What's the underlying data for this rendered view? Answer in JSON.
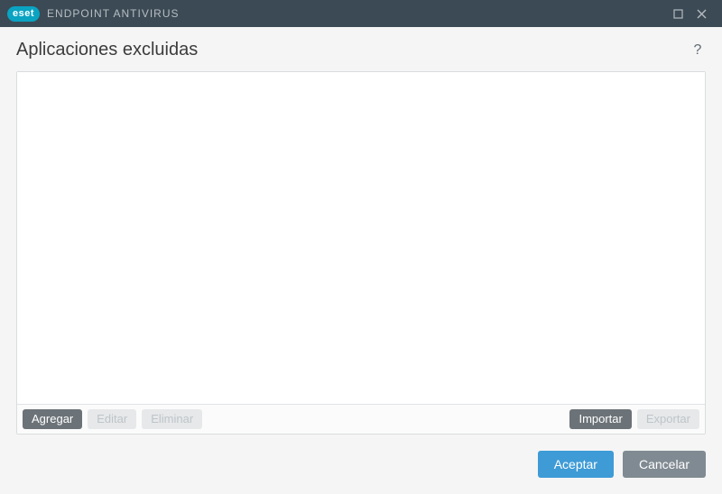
{
  "titlebar": {
    "brand": "eset",
    "product": "ENDPOINT ANTIVIRUS"
  },
  "page": {
    "title": "Aplicaciones excluidas",
    "help": "?"
  },
  "toolbar": {
    "add": "Agregar",
    "edit": "Editar",
    "delete": "Eliminar",
    "import": "Importar",
    "export": "Exportar"
  },
  "footer": {
    "accept": "Aceptar",
    "cancel": "Cancelar"
  },
  "list": {
    "items": []
  }
}
